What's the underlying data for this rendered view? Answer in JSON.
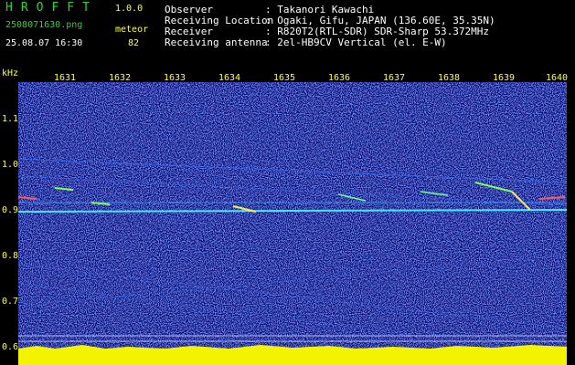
{
  "header": {
    "app_name": "HROFFT",
    "version": "1.0.0",
    "filename": "2508071630.png",
    "datetime": "25.08.07 16:30",
    "meteor_label": "meteor",
    "meteor_count": "82",
    "info_labels": [
      "Observer",
      "Receiving Location",
      "Receiver",
      "Receiving antenna"
    ],
    "info_values": [
      ": Takanori Kawachi",
      ": Ogaki, Gifu, JAPAN (136.60E, 35.35N)",
      ": R820T2(RTL-SDR) SDR-Sharp 53.372MHz",
      ": 2el-HB9CV Vertical (el. E-W)"
    ]
  },
  "axes": {
    "y_unit": "kHz",
    "y_ticks": [
      "1.1",
      "1.0",
      "0.9",
      "0.8",
      "0.7",
      "0.6"
    ],
    "x_ticks": [
      "1631",
      "1632",
      "1633",
      "1634",
      "1635",
      "1636",
      "1637",
      "1638",
      "1639",
      "1640"
    ]
  },
  "colors": {
    "background": "#000000",
    "spectrum_bg": "#0a0a6e",
    "text_green": "#2fd52f",
    "text_yellow": "#ffff3c",
    "carrier": "#49e6ff",
    "bar": "#f3f300"
  }
}
